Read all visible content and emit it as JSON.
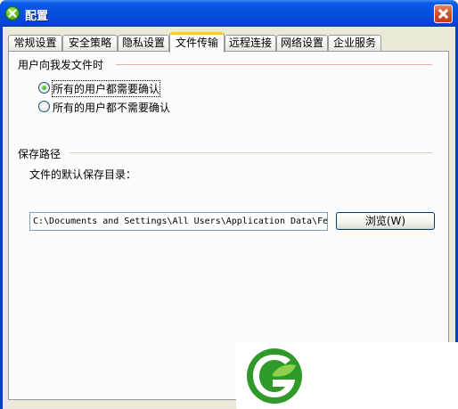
{
  "window": {
    "title": "配置",
    "app_icon": "green-x-circle-icon",
    "close_icon": "close-icon"
  },
  "tabs": [
    {
      "label": "常规设置",
      "active": false
    },
    {
      "label": "安全策略",
      "active": false
    },
    {
      "label": "隐私设置",
      "active": false
    },
    {
      "label": "文件传输",
      "active": true
    },
    {
      "label": "远程连接",
      "active": false
    },
    {
      "label": "网络设置",
      "active": false
    },
    {
      "label": "企业服务",
      "active": false
    }
  ],
  "incoming": {
    "group_label": "用户向我发文件时",
    "options": [
      {
        "label": "所有的用户都需要确认",
        "checked": true
      },
      {
        "label": "所有的用户都不需要确认",
        "checked": false
      }
    ]
  },
  "save": {
    "group_label": "保存路径",
    "field_label": "文件的默认保存目录：",
    "path_value": "C:\\Documents and Settings\\All Users\\Application Data\\Fe",
    "browse_label": "浏览(W)"
  },
  "brand": {
    "logo_icon": "green-leaf-circle-logo",
    "colors": {
      "primary": "#2f9a2a",
      "light": "#8fd14f"
    }
  }
}
